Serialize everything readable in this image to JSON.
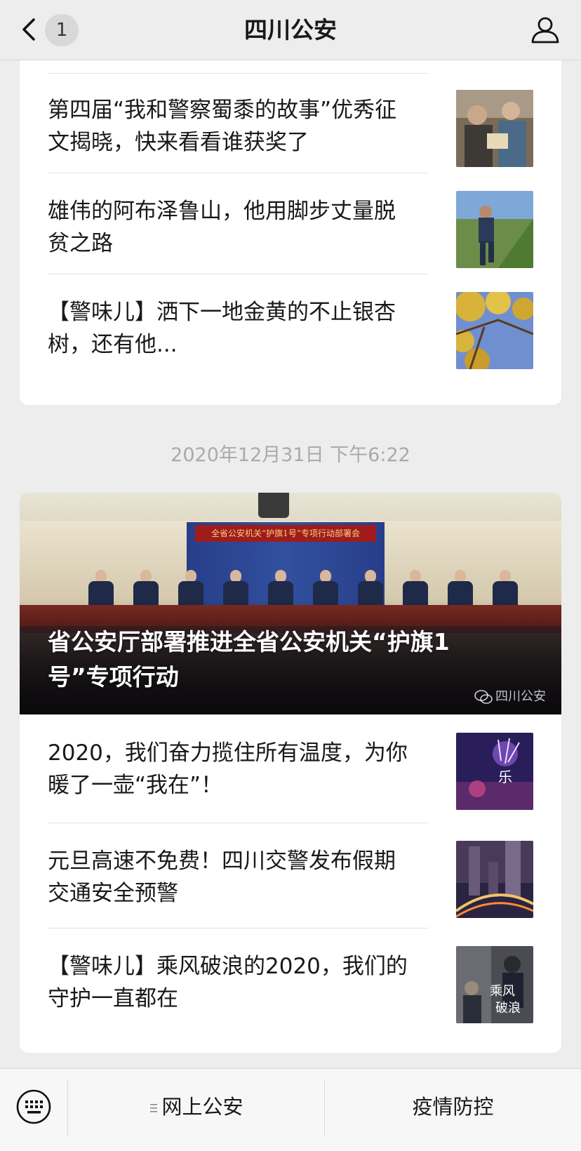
{
  "nav": {
    "unread_count": "1",
    "title": "四川公安",
    "icons": {
      "back": "chevron-left-icon",
      "profile": "person-icon"
    }
  },
  "feed": {
    "group1": {
      "articles": [
        {
          "title": "第四届“我和警察蜀黍的故事”优秀征文揭晓，快来看看谁获奖了",
          "thumb": "photo-elderly-people-icon"
        },
        {
          "title": "雄伟的阿布泽鲁山，他用脚步丈量脱贫之路",
          "thumb": "photo-police-hiking-icon"
        },
        {
          "title": "【警味儿】洒下一地金黄的不止银杏树，还有他...",
          "thumb": "photo-ginkgo-tree-icon"
        }
      ]
    },
    "timestamp": "2020年12月31日 下午6:22",
    "group2": {
      "hero": {
        "title": "省公安厅部署推进全省公安机关“护旗1号”专项行动",
        "banner": "全省公安机关“护旗1号”专项行动部署会",
        "watermark": "四川公安"
      },
      "articles": [
        {
          "title": "2020，我们奋力揽住所有温度，为你暖了一壶“我在”！",
          "thumb": "photo-new-year-poster-icon"
        },
        {
          "title": "元旦高速不免费！四川交警发布假期交通安全预警",
          "thumb": "photo-city-night-traffic-icon"
        },
        {
          "title": "【警味儿】乘风破浪的2020，我们的守护一直都在",
          "thumb": "photo-police-poster-icon"
        }
      ]
    }
  },
  "bottom_menu": {
    "keyboard_icon": "keyboard-icon",
    "items": [
      {
        "label": "网上公安"
      },
      {
        "label": "疫情防控"
      }
    ]
  }
}
